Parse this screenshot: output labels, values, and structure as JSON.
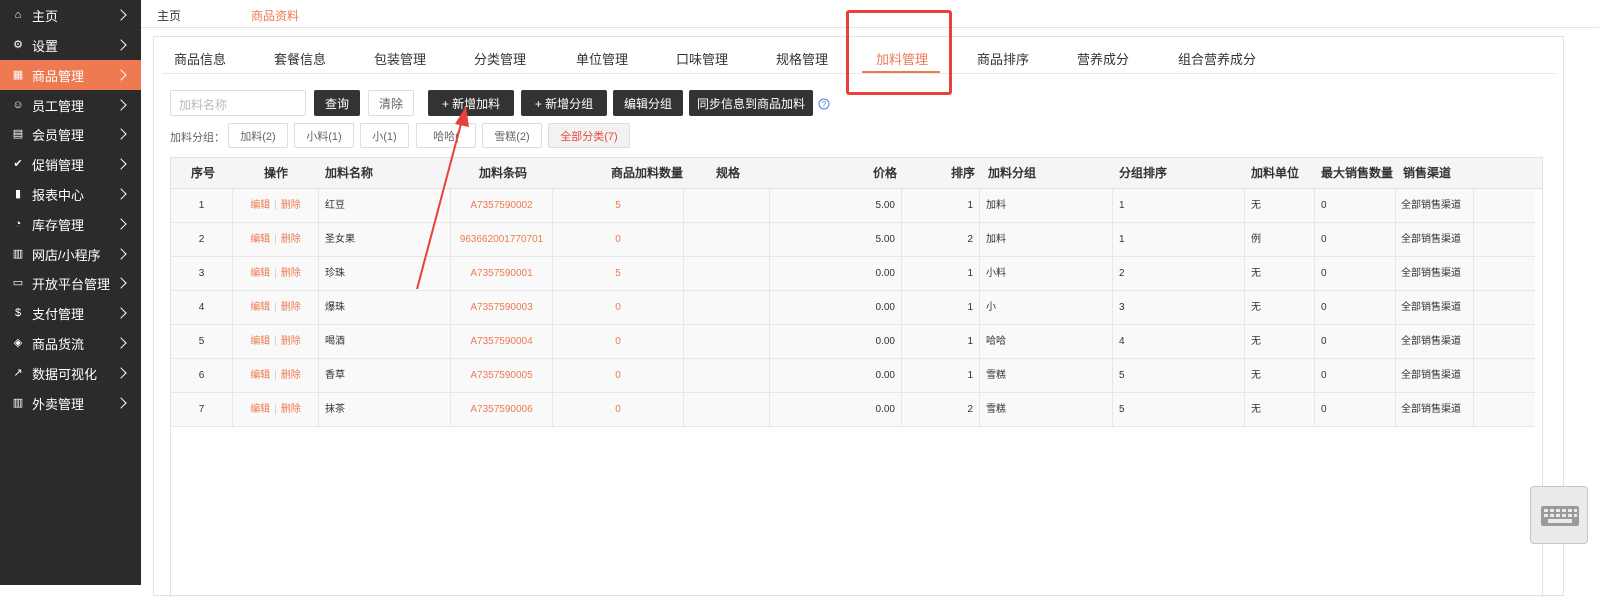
{
  "sidebar": {
    "items": [
      {
        "label": "主页",
        "icon": "home-icon",
        "glyph": "⌂"
      },
      {
        "label": "设置",
        "icon": "gear-icon",
        "glyph": "⚙"
      },
      {
        "label": "商品管理",
        "icon": "grid-icon",
        "glyph": "▦"
      },
      {
        "label": "员工管理",
        "icon": "user-icon",
        "glyph": "☺"
      },
      {
        "label": "会员管理",
        "icon": "member-card-icon",
        "glyph": "▤"
      },
      {
        "label": "促销管理",
        "icon": "check-circle-icon",
        "glyph": "✔"
      },
      {
        "label": "报表中心",
        "icon": "bar-chart-icon",
        "glyph": "▮"
      },
      {
        "label": "库存管理",
        "icon": "pie-chart-icon",
        "glyph": "◔"
      },
      {
        "label": "网店/小程序",
        "icon": "store-icon",
        "glyph": "▥"
      },
      {
        "label": "开放平台管理",
        "icon": "monitor-icon",
        "glyph": "▭"
      },
      {
        "label": "支付管理",
        "icon": "currency-icon",
        "glyph": "$"
      },
      {
        "label": "商品货流",
        "icon": "cube-icon",
        "glyph": "◈"
      },
      {
        "label": "数据可视化",
        "icon": "line-chart-icon",
        "glyph": "↗"
      },
      {
        "label": "外卖管理",
        "icon": "shop-icon",
        "glyph": "▥"
      }
    ],
    "active_index": 2,
    "active_color": "#ee7a52"
  },
  "breadcrumb": {
    "home": "主页",
    "current": "商品资料"
  },
  "tabs": [
    "商品信息",
    "套餐信息",
    "包装管理",
    "分类管理",
    "单位管理",
    "口味管理",
    "规格管理",
    "加料管理",
    "商品排序",
    "营养成分",
    "组合营养成分"
  ],
  "active_tab": "加料管理",
  "search": {
    "placeholder": "加料名称",
    "value": ""
  },
  "buttons": {
    "query": "查询",
    "clear": "清除",
    "add_addon": "+ 新增加料",
    "add_group": "+ 新增分组",
    "edit_group": "编辑分组",
    "sync": "同步信息到商品加料"
  },
  "group_filter": {
    "label": "加料分组：",
    "tags": [
      "加料(2)",
      "小料(1)",
      "小(1)",
      "哈哈(",
      "雪糕(2)",
      "全部分类(7)"
    ],
    "active_index": 5
  },
  "table": {
    "headers": [
      "序号",
      "操作",
      "加料名称",
      "加料条码",
      "商品加料数量",
      "规格",
      "价格",
      "排序",
      "加料分组",
      "分组排序",
      "加料单位",
      "最大销售数量",
      "销售渠道"
    ],
    "edit_label": "编辑",
    "delete_label": "删除",
    "rows": [
      {
        "no": "1",
        "name": "红豆",
        "barcode": "A7357590002",
        "qty": "5",
        "spec": "",
        "price": "5.00",
        "sort": "1",
        "group": "加料",
        "group_sort": "1",
        "unit": "无",
        "max": "0",
        "channel": "全部销售渠道"
      },
      {
        "no": "2",
        "name": "圣女果",
        "barcode": "963662001770701",
        "qty": "0",
        "spec": "",
        "price": "5.00",
        "sort": "2",
        "group": "加料",
        "group_sort": "1",
        "unit": "例",
        "max": "0",
        "channel": "全部销售渠道"
      },
      {
        "no": "3",
        "name": "珍珠",
        "barcode": "A7357590001",
        "qty": "5",
        "spec": "",
        "price": "0.00",
        "sort": "1",
        "group": "小料",
        "group_sort": "2",
        "unit": "无",
        "max": "0",
        "channel": "全部销售渠道"
      },
      {
        "no": "4",
        "name": "爆珠",
        "barcode": "A7357590003",
        "qty": "0",
        "spec": "",
        "price": "0.00",
        "sort": "1",
        "group": "小",
        "group_sort": "3",
        "unit": "无",
        "max": "0",
        "channel": "全部销售渠道"
      },
      {
        "no": "5",
        "name": "喝酒",
        "barcode": "A7357590004",
        "qty": "0",
        "spec": "",
        "price": "0.00",
        "sort": "1",
        "group": "哈哈",
        "group_sort": "4",
        "unit": "无",
        "max": "0",
        "channel": "全部销售渠道"
      },
      {
        "no": "6",
        "name": "香草",
        "barcode": "A7357590005",
        "qty": "0",
        "spec": "",
        "price": "0.00",
        "sort": "1",
        "group": "雪糕",
        "group_sort": "5",
        "unit": "无",
        "max": "0",
        "channel": "全部销售渠道"
      },
      {
        "no": "7",
        "name": "抹茶",
        "barcode": "A7357590006",
        "qty": "0",
        "spec": "",
        "price": "0.00",
        "sort": "2",
        "group": "雪糕",
        "group_sort": "5",
        "unit": "无",
        "max": "0",
        "channel": "全部销售渠道"
      }
    ]
  },
  "annotation_color": "#e8403a",
  "help_icon": "question-circle-icon",
  "keyboard_icon": "keyboard-icon"
}
